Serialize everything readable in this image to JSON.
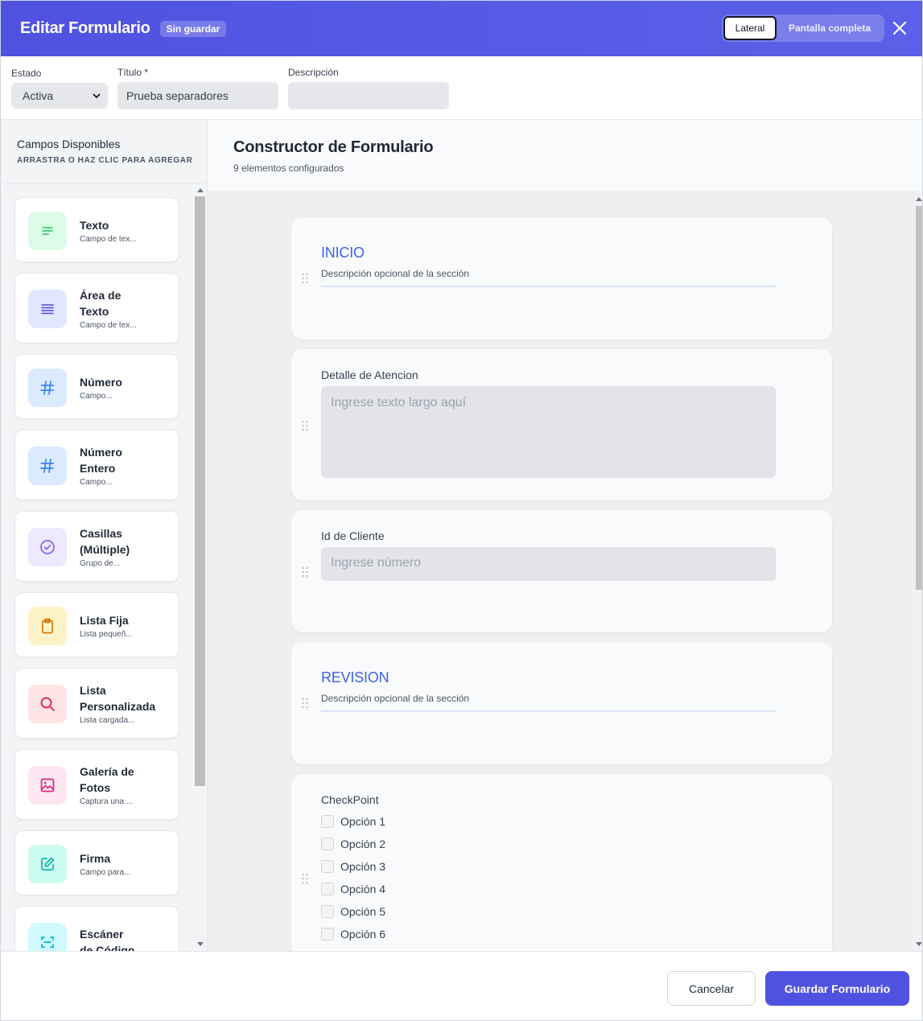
{
  "header": {
    "title": "Editar Formulario",
    "badge": "Sin guardar",
    "view_lateral": "Lateral",
    "view_fullscreen": "Pantalla completa",
    "colors": {
      "accent": "#4f52e0"
    }
  },
  "form": {
    "estado_label": "Estado",
    "estado_value": "Activa",
    "titulo_label": "Título *",
    "titulo_value": "Prueba separadores",
    "descripcion_label": "Descripción",
    "descripcion_value": ""
  },
  "sidebar": {
    "title": "Campos Disponibles",
    "subtitle": "ARRASTRA O HAZ CLIC PARA AGREGAR",
    "fields": [
      {
        "name": "Texto",
        "desc": "Campo de tex...",
        "icon": "text-lines-icon",
        "color": "#22c55e",
        "bg": "#dcfce7"
      },
      {
        "name": "Área de\nTexto",
        "desc": "Campo de tex...",
        "icon": "textarea-lines-icon",
        "color": "#4f46e5",
        "bg": "#e0e7ff"
      },
      {
        "name": "Número",
        "desc": "Campo...",
        "icon": "hash-icon",
        "color": "#3b82f6",
        "bg": "#dbeafe"
      },
      {
        "name": "Número\nEntero",
        "desc": "Campo...",
        "icon": "hash-icon",
        "color": "#3b82f6",
        "bg": "#dbeafe"
      },
      {
        "name": "Casillas\n(Múltiple)",
        "desc": "Grupo de...",
        "icon": "check-circle-icon",
        "color": "#8b5cf6",
        "bg": "#ede9fe"
      },
      {
        "name": "Lista Fija",
        "desc": "Lista pequeñ...",
        "icon": "clipboard-icon",
        "color": "#d97706",
        "bg": "#fef3c7"
      },
      {
        "name": "Lista\nPersonalizada",
        "desc": "Lista cargada...",
        "icon": "search-icon",
        "color": "#e11d48",
        "bg": "#ffe4e6"
      },
      {
        "name": "Galería de\nFotos",
        "desc": "Captura una ...",
        "icon": "image-icon",
        "color": "#db2777",
        "bg": "#fce7f3"
      },
      {
        "name": "Firma",
        "desc": "Campo para...",
        "icon": "pen-square-icon",
        "color": "#14b8a6",
        "bg": "#ccfbf1"
      },
      {
        "name": "Escáner\nde Código",
        "desc": "",
        "icon": "scan-icon",
        "color": "#06b6d4",
        "bg": "#cffafe"
      }
    ]
  },
  "builder": {
    "title": "Constructor de Formulario",
    "subtitle": "9 elementos configurados",
    "section1": {
      "title": "INICIO",
      "desc": "Descripción opcional de la sección"
    },
    "field1": {
      "label": "Detalle de Atencion",
      "placeholder": "Ingrese texto largo aquí"
    },
    "field2": {
      "label": "Id de Cliente",
      "placeholder": "Ingrese número"
    },
    "section2": {
      "title": "REVISION",
      "desc": "Descripción opcional de la sección"
    },
    "field3": {
      "label": "CheckPoint",
      "options": [
        "Opción 1",
        "Opción 2",
        "Opción 3",
        "Opción 4",
        "Opción 5",
        "Opción 6"
      ]
    }
  },
  "footer": {
    "cancel": "Cancelar",
    "save": "Guardar Formulario"
  }
}
